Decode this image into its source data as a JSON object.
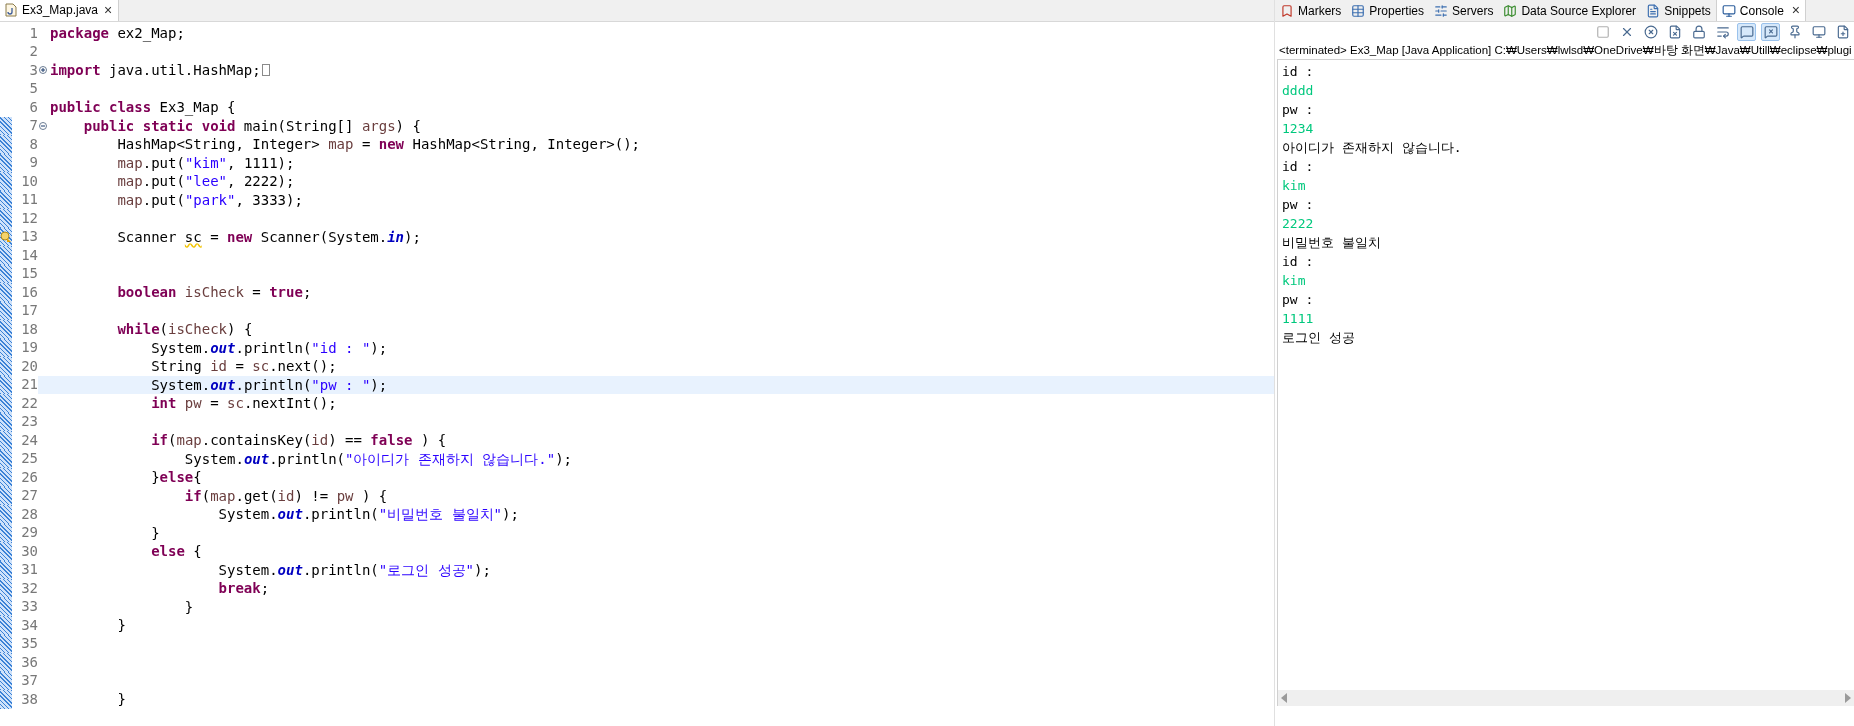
{
  "editor": {
    "tab": {
      "title": "Ex3_Map.java",
      "selected": true,
      "close": "×"
    },
    "lines": [
      {
        "number": "1",
        "changed": false,
        "tokens": [
          {
            "text": "package",
            "kind": "keyword"
          },
          {
            "text": " ex2_Map;",
            "kind": "plain"
          }
        ]
      },
      {
        "number": "2",
        "changed": false
      },
      {
        "number": "3",
        "changed": false,
        "expanded": false,
        "folded_more": true,
        "tokens": [
          {
            "text": "import",
            "kind": "keyword"
          },
          {
            "text": " java.util.HashMap;",
            "kind": "plain"
          }
        ]
      },
      {
        "number": "5",
        "changed": false
      },
      {
        "number": "6",
        "changed": false,
        "tokens": [
          {
            "text": "public class",
            "kind": "keyword"
          },
          {
            "text": " Ex3_Map {",
            "kind": "plain"
          }
        ]
      },
      {
        "number": "7",
        "changed": true,
        "expanded": true,
        "tokens": [
          {
            "text": "    public static void",
            "kind": "keyword"
          },
          {
            "text": " main(String[] ",
            "kind": "plain"
          },
          {
            "text": "args",
            "kind": "local"
          },
          {
            "text": ") {",
            "kind": "plain"
          }
        ]
      },
      {
        "number": "8",
        "changed": true,
        "tokens": [
          {
            "text": "        HashMap<String, Integer> ",
            "kind": "plain"
          },
          {
            "text": "map",
            "kind": "local"
          },
          {
            "text": " = ",
            "kind": "plain"
          },
          {
            "text": "new",
            "kind": "keyword"
          },
          {
            "text": " HashMap<String, Integer>();",
            "kind": "plain"
          }
        ]
      },
      {
        "number": "9",
        "changed": true,
        "tokens": [
          {
            "text": "        map",
            "kind": "local"
          },
          {
            "text": ".put(",
            "kind": "plain"
          },
          {
            "text": "\"kim\"",
            "kind": "string"
          },
          {
            "text": ", 1111);",
            "kind": "plain"
          }
        ]
      },
      {
        "number": "10",
        "changed": true,
        "tokens": [
          {
            "text": "        map",
            "kind": "local"
          },
          {
            "text": ".put(",
            "kind": "plain"
          },
          {
            "text": "\"lee\"",
            "kind": "string"
          },
          {
            "text": ", 2222);",
            "kind": "plain"
          }
        ]
      },
      {
        "number": "11",
        "changed": true,
        "tokens": [
          {
            "text": "        map",
            "kind": "local"
          },
          {
            "text": ".put(",
            "kind": "plain"
          },
          {
            "text": "\"park\"",
            "kind": "string"
          },
          {
            "text": ", 3333);",
            "kind": "plain"
          }
        ]
      },
      {
        "number": "12",
        "changed": true
      },
      {
        "number": "13",
        "changed": true,
        "warning": true,
        "tokens": [
          {
            "text": "        Scanner ",
            "kind": "plain"
          },
          {
            "text": "sc",
            "kind": "warned"
          },
          {
            "text": " = ",
            "kind": "plain"
          },
          {
            "text": "new",
            "kind": "keyword"
          },
          {
            "text": " Scanner(System.",
            "kind": "plain"
          },
          {
            "text": "in",
            "kind": "field"
          },
          {
            "text": ");",
            "kind": "plain"
          }
        ]
      },
      {
        "number": "14",
        "changed": true
      },
      {
        "number": "15",
        "changed": true
      },
      {
        "number": "16",
        "changed": true,
        "tokens": [
          {
            "text": "        boolean",
            "kind": "keyword"
          },
          {
            "text": " isCheck",
            "kind": "local"
          },
          {
            "text": " = ",
            "kind": "plain"
          },
          {
            "text": "true",
            "kind": "keyword"
          },
          {
            "text": ";",
            "kind": "plain"
          }
        ]
      },
      {
        "number": "17",
        "changed": true
      },
      {
        "number": "18",
        "changed": true,
        "tokens": [
          {
            "text": "        while",
            "kind": "keyword"
          },
          {
            "text": "(",
            "kind": "plain"
          },
          {
            "text": "isCheck",
            "kind": "local"
          },
          {
            "text": ") {",
            "kind": "plain"
          }
        ]
      },
      {
        "number": "19",
        "changed": true,
        "tokens": [
          {
            "text": "            System.",
            "kind": "plain"
          },
          {
            "text": "out",
            "kind": "field"
          },
          {
            "text": ".println(",
            "kind": "plain"
          },
          {
            "text": "\"id : \"",
            "kind": "string"
          },
          {
            "text": ");",
            "kind": "plain"
          }
        ]
      },
      {
        "number": "20",
        "changed": true,
        "tokens": [
          {
            "text": "            String ",
            "kind": "plain"
          },
          {
            "text": "id",
            "kind": "local"
          },
          {
            "text": " = ",
            "kind": "plain"
          },
          {
            "text": "sc",
            "kind": "local"
          },
          {
            "text": ".next();",
            "kind": "plain"
          }
        ]
      },
      {
        "number": "21",
        "changed": true,
        "highlighted": true,
        "tokens": [
          {
            "text": "            System.",
            "kind": "plain"
          },
          {
            "text": "out",
            "kind": "field"
          },
          {
            "text": ".println(",
            "kind": "plain"
          },
          {
            "text": "\"pw : \"",
            "kind": "string"
          },
          {
            "text": ");",
            "kind": "plain"
          }
        ]
      },
      {
        "number": "22",
        "changed": true,
        "tokens": [
          {
            "text": "            int",
            "kind": "keyword"
          },
          {
            "text": " pw",
            "kind": "local"
          },
          {
            "text": " = ",
            "kind": "plain"
          },
          {
            "text": "sc",
            "kind": "local"
          },
          {
            "text": ".nextInt();",
            "kind": "plain"
          }
        ]
      },
      {
        "number": "23",
        "changed": true
      },
      {
        "number": "24",
        "changed": true,
        "tokens": [
          {
            "text": "            if",
            "kind": "keyword"
          },
          {
            "text": "(",
            "kind": "plain"
          },
          {
            "text": "map",
            "kind": "local"
          },
          {
            "text": ".containsKey(",
            "kind": "plain"
          },
          {
            "text": "id",
            "kind": "local"
          },
          {
            "text": ") == ",
            "kind": "plain"
          },
          {
            "text": "false",
            "kind": "keyword"
          },
          {
            "text": " ) {",
            "kind": "plain"
          }
        ]
      },
      {
        "number": "25",
        "changed": true,
        "tokens": [
          {
            "text": "                System.",
            "kind": "plain"
          },
          {
            "text": "out",
            "kind": "field"
          },
          {
            "text": ".println(",
            "kind": "plain"
          },
          {
            "text": "\"아이디가 존재하지 않습니다.\"",
            "kind": "string"
          },
          {
            "text": ");",
            "kind": "plain"
          }
        ]
      },
      {
        "number": "26",
        "changed": true,
        "tokens": [
          {
            "text": "            }",
            "kind": "plain"
          },
          {
            "text": "else",
            "kind": "keyword"
          },
          {
            "text": "{",
            "kind": "plain"
          }
        ]
      },
      {
        "number": "27",
        "changed": true,
        "tokens": [
          {
            "text": "                if",
            "kind": "keyword"
          },
          {
            "text": "(",
            "kind": "plain"
          },
          {
            "text": "map",
            "kind": "local"
          },
          {
            "text": ".get(",
            "kind": "plain"
          },
          {
            "text": "id",
            "kind": "local"
          },
          {
            "text": ") != ",
            "kind": "plain"
          },
          {
            "text": "pw",
            "kind": "local"
          },
          {
            "text": " ) {",
            "kind": "plain"
          }
        ]
      },
      {
        "number": "28",
        "changed": true,
        "tokens": [
          {
            "text": "                    System.",
            "kind": "plain"
          },
          {
            "text": "out",
            "kind": "field"
          },
          {
            "text": ".println(",
            "kind": "plain"
          },
          {
            "text": "\"비밀번호 불일치\"",
            "kind": "string"
          },
          {
            "text": ");",
            "kind": "plain"
          }
        ]
      },
      {
        "number": "29",
        "changed": true,
        "tokens": [
          {
            "text": "            }",
            "kind": "plain"
          }
        ]
      },
      {
        "number": "30",
        "changed": true,
        "tokens": [
          {
            "text": "            else",
            "kind": "keyword"
          },
          {
            "text": " {",
            "kind": "plain"
          }
        ]
      },
      {
        "number": "31",
        "changed": true,
        "tokens": [
          {
            "text": "                    System.",
            "kind": "plain"
          },
          {
            "text": "out",
            "kind": "field"
          },
          {
            "text": ".println(",
            "kind": "plain"
          },
          {
            "text": "\"로그인 성공\"",
            "kind": "string"
          },
          {
            "text": ");",
            "kind": "plain"
          }
        ]
      },
      {
        "number": "32",
        "changed": true,
        "tokens": [
          {
            "text": "                    break",
            "kind": "keyword"
          },
          {
            "text": ";",
            "kind": "plain"
          }
        ]
      },
      {
        "number": "33",
        "changed": true,
        "tokens": [
          {
            "text": "                }",
            "kind": "plain"
          }
        ]
      },
      {
        "number": "34",
        "changed": true,
        "tokens": [
          {
            "text": "        }",
            "kind": "plain"
          }
        ]
      },
      {
        "number": "35",
        "changed": true
      },
      {
        "number": "36",
        "changed": true
      },
      {
        "number": "37",
        "changed": true
      },
      {
        "number": "38",
        "changed": true,
        "tokens": [
          {
            "text": "        }",
            "kind": "plain"
          }
        ]
      }
    ]
  },
  "views": {
    "tabs": [
      {
        "label": "Markers",
        "selected": false
      },
      {
        "label": "Properties",
        "selected": false
      },
      {
        "label": "Servers",
        "selected": false
      },
      {
        "label": "Data Source Explorer",
        "selected": false
      },
      {
        "label": "Snippets",
        "selected": false
      },
      {
        "label": "Console",
        "selected": true,
        "close": "×"
      }
    ],
    "toolbar": [
      {
        "disabled": true
      },
      {
        "disabled": false
      },
      {
        "disabled": false
      },
      {
        "disabled": false
      },
      {
        "disabled": false
      },
      {
        "disabled": false
      },
      {
        "disabled": false,
        "selected": true
      },
      {
        "disabled": false,
        "selected": true
      },
      {
        "disabled": false
      },
      {
        "disabled": false
      },
      {
        "disabled": false
      }
    ],
    "status": "<terminated> Ex3_Map [Java Application] C:₩Users₩lwlsd₩OneDrive₩바탕 화면₩Java₩Utill₩eclipse₩plugi",
    "output": [
      {
        "text": "id :",
        "kind": "out"
      },
      {
        "text": "dddd",
        "kind": "in"
      },
      {
        "text": "pw :",
        "kind": "out"
      },
      {
        "text": "1234",
        "kind": "in"
      },
      {
        "text": "아이디가 존재하지 않습니다.",
        "kind": "out"
      },
      {
        "text": "id :",
        "kind": "out"
      },
      {
        "text": "kim",
        "kind": "in"
      },
      {
        "text": "pw :",
        "kind": "out"
      },
      {
        "text": "2222",
        "kind": "in"
      },
      {
        "text": "비밀번호 불일치",
        "kind": "out"
      },
      {
        "text": "id :",
        "kind": "out"
      },
      {
        "text": "kim",
        "kind": "in"
      },
      {
        "text": "pw :",
        "kind": "out"
      },
      {
        "text": "1111",
        "kind": "in"
      },
      {
        "text": "로그인 성공",
        "kind": "out"
      }
    ]
  }
}
